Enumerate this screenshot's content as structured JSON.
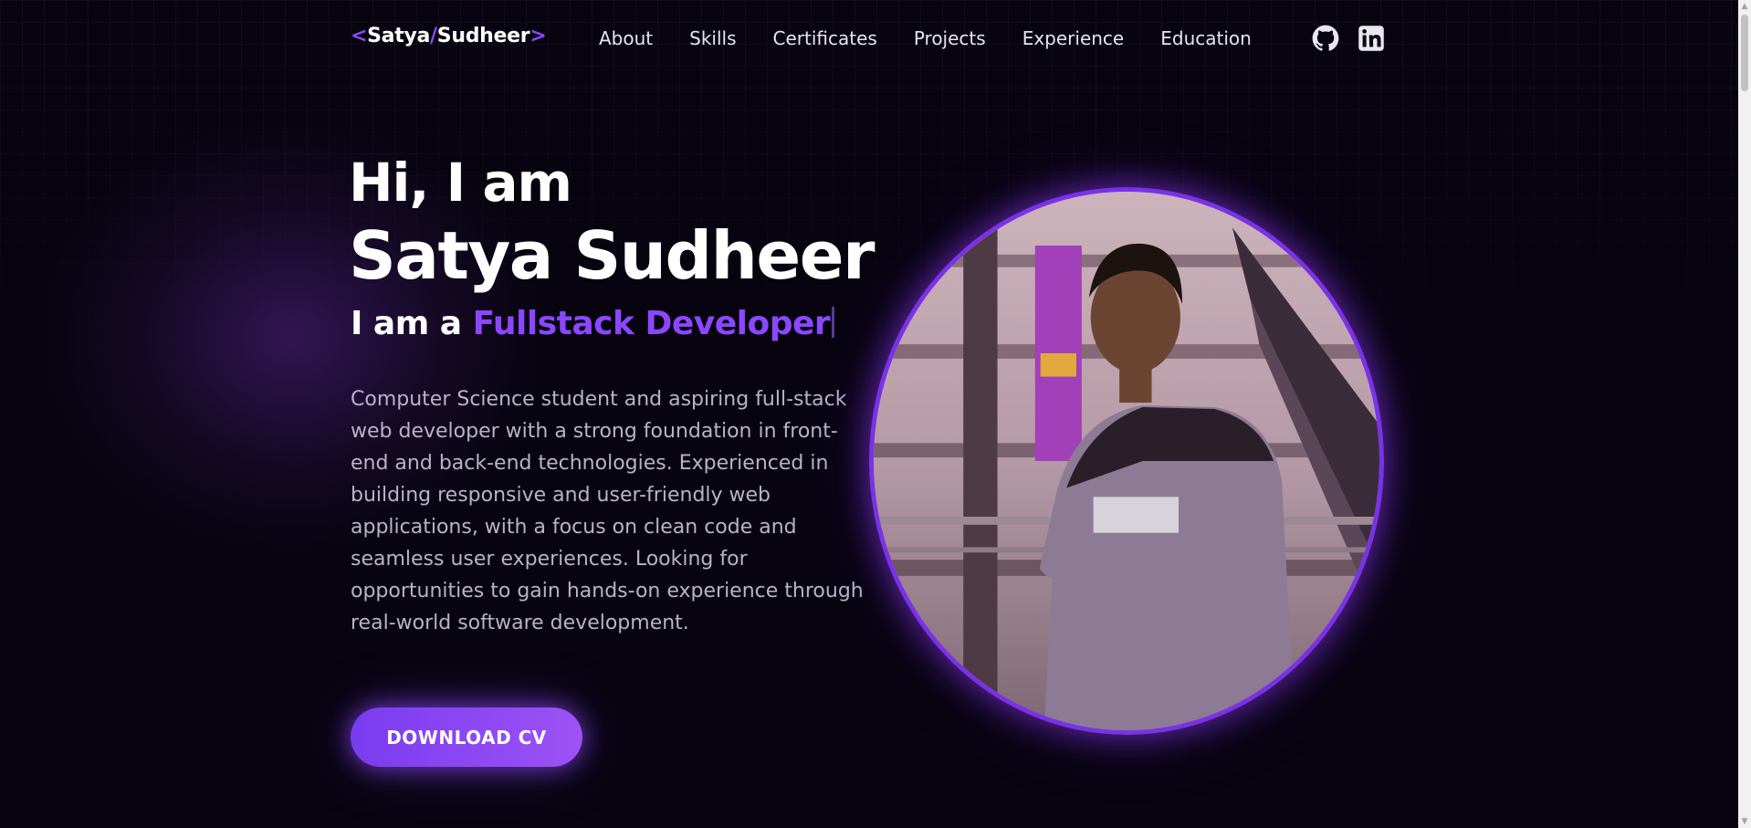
{
  "nav": {
    "logo": {
      "open": "<",
      "first": "Satya",
      "slash": "/",
      "last": "Sudheer",
      "close": ">"
    },
    "links": [
      "About",
      "Skills",
      "Certificates",
      "Projects",
      "Experience",
      "Education"
    ],
    "social": [
      {
        "icon": "github-icon"
      },
      {
        "icon": "linkedin-icon"
      }
    ]
  },
  "hero": {
    "greeting": "Hi, I am",
    "name": "Satya Sudheer",
    "role_prefix": "I am a",
    "role_highlight": "Fullstack Developer",
    "bio": "Computer Science student and aspiring full-stack web developer with a strong foundation in front-end and back-end technologies. Experienced in building responsive and user-friendly web applications, with a focus on clean code and seamless user experiences. Looking for opportunities to gain hands-on experience through real-world software development.",
    "cta_label": "DOWNLOAD CV"
  },
  "theme": {
    "background": "#07040f",
    "accent": "#8b47ff",
    "text_muted": "#b8b3c7"
  }
}
